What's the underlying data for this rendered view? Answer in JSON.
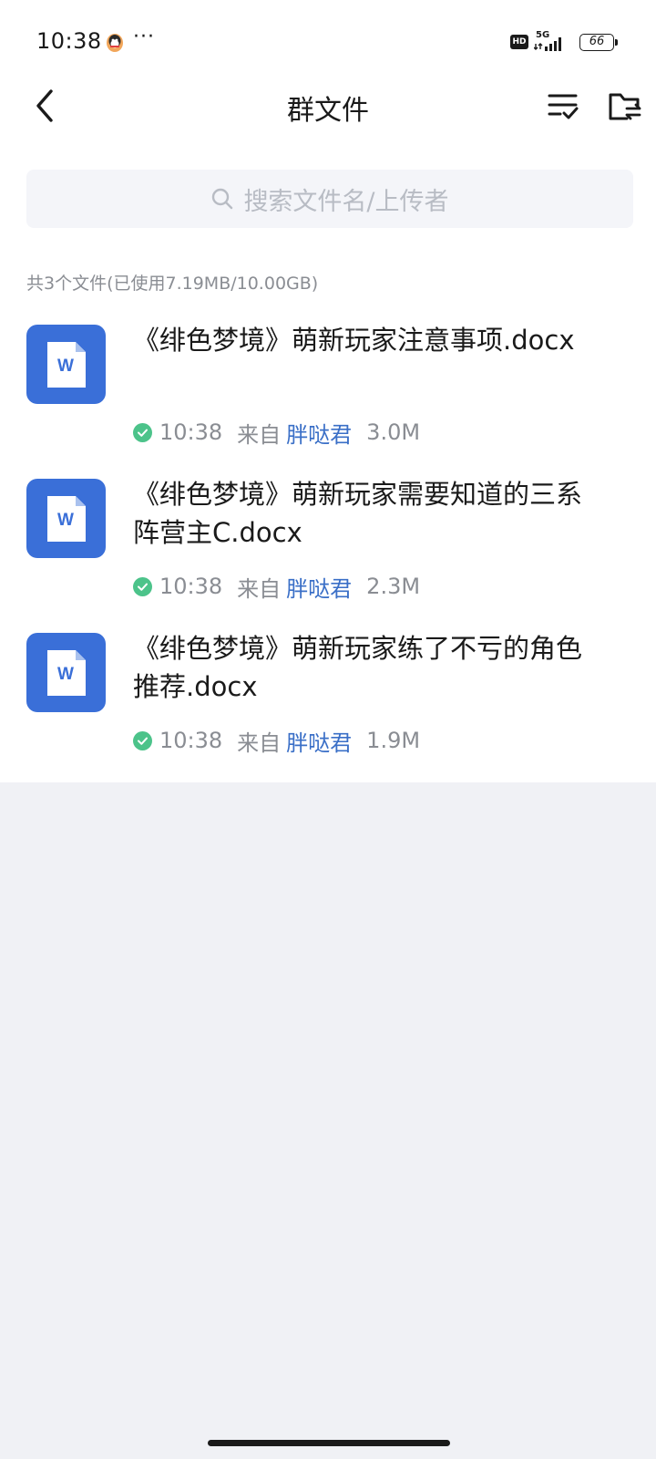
{
  "status_bar": {
    "time": "10:38",
    "more": "···",
    "hd": "HD",
    "network": "5G",
    "battery": "66"
  },
  "header": {
    "title": "群文件"
  },
  "search": {
    "placeholder": "搜索文件名/上传者"
  },
  "summary": "共3个文件(已使用7.19MB/10.00GB)",
  "files": [
    {
      "name": "《绯色梦境》萌新玩家注意事项.docx",
      "time": "10:38",
      "from_label": "来自",
      "uploader": "胖哒君",
      "size": "3.0M"
    },
    {
      "name": "《绯色梦境》萌新玩家需要知道的三系阵营主C.docx",
      "time": "10:38",
      "from_label": "来自",
      "uploader": "胖哒君",
      "size": "2.3M"
    },
    {
      "name": "《绯色梦境》萌新玩家练了不亏的角色推荐.docx",
      "time": "10:38",
      "from_label": "来自",
      "uploader": "胖哒君",
      "size": "1.9M"
    }
  ],
  "icons": {
    "file_type": "word-doc-icon",
    "status": "check-circle-icon"
  },
  "colors": {
    "accent_blue": "#3a6fd8",
    "uploader_blue": "#3a6fc7",
    "check_green": "#4cc38a",
    "background": "#f0f1f5"
  }
}
